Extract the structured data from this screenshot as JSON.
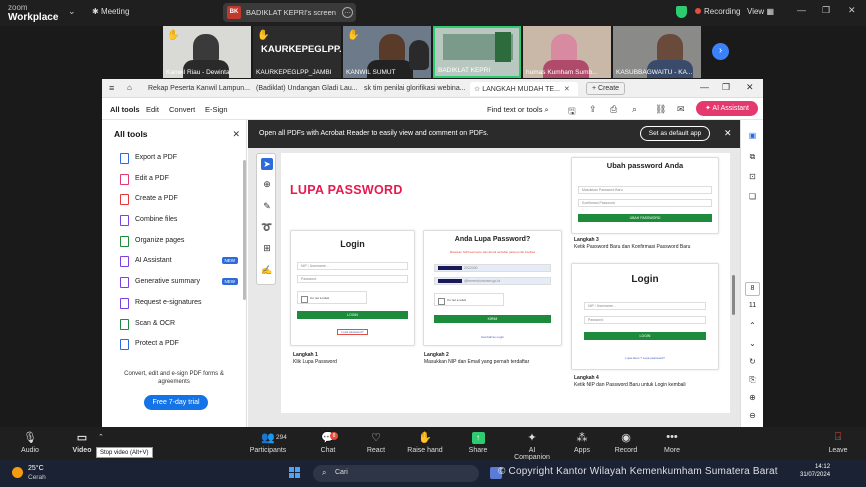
{
  "zoom_top": {
    "logo_line1": "zoom",
    "logo_line2": "Workplace",
    "meeting_label": "Meeting",
    "share_badge": "BK",
    "share_text": "BADIKLAT KEPRI's screen",
    "recording_label": "Recording",
    "view_label": "View"
  },
  "participants": [
    {
      "name": "Kanwil Riau - Dewinta",
      "hand": true
    },
    {
      "name": "KAURKEPEGLPP_JAMBI",
      "hand": true,
      "display_text": "KAURKEPEGLPP..."
    },
    {
      "name": "KANWIL SUMUT",
      "hand": true
    },
    {
      "name": "BADIKLAT KEPRI",
      "hand": false
    },
    {
      "name": "humas Kumham Sumb...",
      "hand": false
    },
    {
      "name": "KASUBBAGWAITU - KA...",
      "hand": false
    }
  ],
  "acrobat": {
    "tabs": [
      {
        "label": "Rekap Peserta Kanwil Lampun..."
      },
      {
        "label": "(Badiklat) Undangan Gladi Lau..."
      },
      {
        "label": "sk tim penilai glorifikasi webina..."
      },
      {
        "label": "LANGKAH MUDAH TE..."
      }
    ],
    "create_label": "+ Create",
    "menus": [
      "All tools",
      "Edit",
      "Convert",
      "E-Sign"
    ],
    "find_label": "Find text or tools",
    "ai_assistant_label": "AI Assistant",
    "panel_title": "All tools",
    "tools": [
      {
        "label": "Export a PDF",
        "color": "#2d6bd9"
      },
      {
        "label": "Edit a PDF",
        "color": "#e4386e"
      },
      {
        "label": "Create a PDF",
        "color": "#e53935"
      },
      {
        "label": "Combine files",
        "color": "#7b3fe4"
      },
      {
        "label": "Organize pages",
        "color": "#1e8a3c"
      },
      {
        "label": "AI Assistant",
        "color": "#7b3fe4",
        "badge": "NEW"
      },
      {
        "label": "Generative summary",
        "color": "#7b3fe4",
        "badge": "NEW"
      },
      {
        "label": "Request e-signatures",
        "color": "#7b3fe4"
      },
      {
        "label": "Scan & OCR",
        "color": "#1e8a3c"
      },
      {
        "label": "Protect a PDF",
        "color": "#2d6bd9"
      }
    ],
    "promo_text": "Convert, edit and e-sign PDF forms & agreements",
    "trial_label": "Free 7-day trial",
    "banner_text": "Open all PDFs with Acrobat Reader to easily view and comment on PDFs.",
    "default_app_label": "Set as default app",
    "page_number": "8",
    "page_total": "11"
  },
  "slide": {
    "title": "LUPA PASSWORD",
    "login_title": "Login",
    "nip_placeholder": "NIP / Username...",
    "password_placeholder": "Password",
    "not_robot": "I'm not a robot",
    "login_button": "LOGIN",
    "forgot_link": "Lupa password?",
    "forgot_title": "Anda Lupa Password?",
    "forgot_hint": "Masukan NIP/username dan Email terdaftar pada portal Intelitas",
    "nip_value": "2022000",
    "email_value": "@kemenkumham.go.id",
    "kirim_button": "KIRIM",
    "back_link": "Kembali ke Login",
    "ubah_title": "Ubah password Anda",
    "new_pass": "Masukkan Password Baru",
    "confirm_pass": "Konfirmasi Password",
    "ubah_button": "UBAH PASSWORD",
    "forgot_link2": "Lupa Akun ? Lupa password?",
    "step1_title": "Langkah 1",
    "step1_text": "Klik Lupa Password",
    "step2_title": "Langkah 2",
    "step2_text": "Masukkan NIP dan Email yang pernah terdaftar",
    "step3_title": "Langkah 3",
    "step3_text": "Ketik Password Baru dan Konfirmasi Password Baru",
    "step4_title": "Langkah 4",
    "step4_text": "Ketik NIP dan Password Baru untuk Login kembali"
  },
  "zoom_bottom": {
    "audio": "Audio",
    "video": "Video",
    "participants": "Participants",
    "participant_count": "294",
    "chat": "Chat",
    "chat_badge": "8",
    "react": "React",
    "raise_hand": "Raise hand",
    "share": "Share",
    "ai_companion": "AI Companion",
    "apps": "Apps",
    "record": "Record",
    "more": "More",
    "leave": "Leave",
    "tooltip": "Stop video (Alt+V)"
  },
  "taskbar": {
    "temp": "25°C",
    "weather": "Cerah",
    "search": "Cari",
    "watermark": "© Copyright Kantor Wilayah Kemenkumham Sumatera Barat",
    "time": "14:12",
    "date": "31/07/2024"
  }
}
